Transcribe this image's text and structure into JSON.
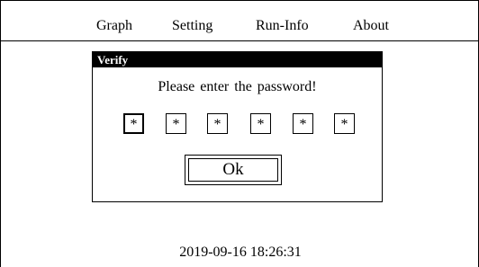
{
  "menu": {
    "items": [
      "Graph",
      "Setting",
      "Run-Info",
      "About"
    ]
  },
  "dialog": {
    "title": "Verify",
    "prompt": "Please enter the password!",
    "password_chars": [
      "*",
      "*",
      "*",
      "*",
      "*",
      "*"
    ],
    "ok_label": "Ok"
  },
  "status": {
    "datetime": "2019-09-16 18:26:31"
  }
}
